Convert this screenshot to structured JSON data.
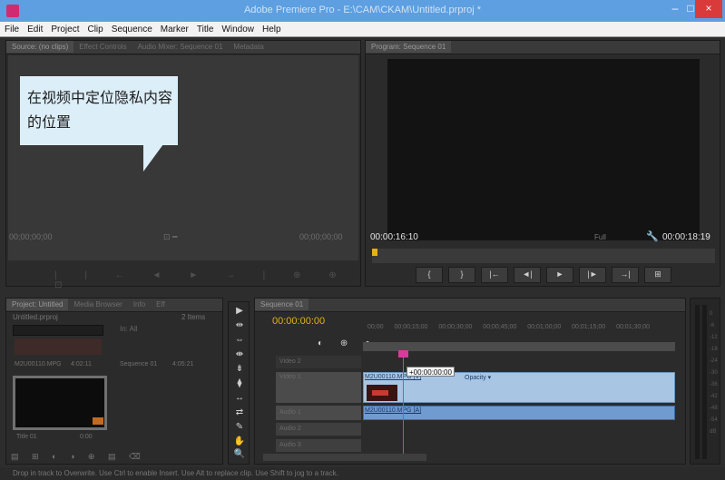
{
  "window": {
    "title": "Adobe Premiere Pro - E:\\CAM\\CKAM\\Untitled.prproj *",
    "minimize": "–",
    "maximize": "□",
    "close": "×"
  },
  "menu": [
    "File",
    "Edit",
    "Project",
    "Clip",
    "Sequence",
    "Marker",
    "Title",
    "Window",
    "Help"
  ],
  "source_panel": {
    "tabs": [
      "Source: (no clips)",
      "Effect Controls",
      "Audio Mixer: Sequence 01",
      "Metadata"
    ],
    "timecode_left": "00;00;00;00",
    "timecode_right": "00;00;00;00",
    "transport": "| | ← ◄ ► → | ⊕ ⊕ ⊡",
    "add_icon": "+"
  },
  "callout": {
    "text": "在视频中定位隐私内容的位置"
  },
  "program_panel": {
    "tab": "Program: Sequence 01",
    "timecode_left": "00:00:16:10",
    "timecode_right": "00:00:18:19",
    "fit": "Full",
    "transport": [
      "{",
      "}",
      "|←",
      "◄|",
      "►",
      "|►",
      "→|",
      "⊞",
      "⊟"
    ]
  },
  "project_panel": {
    "tabs": [
      "Project: Untitled",
      "Media Browser",
      "Info",
      "Eff"
    ],
    "project_name": "Untitled.prproj",
    "items_count": "2 Items",
    "search_placeholder": "",
    "in_label": "In: All",
    "item1_name": "M2U00110.MPG",
    "item1_duration": "4:02:11",
    "item2_name": "Sequence 01",
    "item2_duration": "4:05:21",
    "item3_name": "Title 01",
    "item3_duration": "0:00",
    "bottom_icons": "▤ ⊞ ◐ ◑ ⊕ ▤ ⌫"
  },
  "tools": [
    "▶",
    "⇹",
    "⇔",
    "⇼",
    "⇟",
    "⧫",
    "↔",
    "⇄",
    "✎",
    "✋",
    "🔍"
  ],
  "timeline": {
    "tab": "Sequence 01",
    "timecode": "00:00:00:00",
    "ruler": "00;00  00;00;15;00  00;00;30;00  00;00;45;00  00;01;00;00  00;01;15;00  00;01;30;00",
    "tools": "◐ ⊕ ●",
    "tracks": {
      "video2": "Video 2",
      "video1": "Video 1",
      "audio1": "Audio 1",
      "audio2": "Audio 2",
      "audio3": "Audio 3"
    },
    "video_clip": "M2U00110.MPG [V]",
    "video_clip_opacity": "Opacity ▾",
    "audio_clip": "M2U00110.MPG [A]",
    "tooltip": "+00:00:00:00"
  },
  "meter_scale": [
    "0",
    "-6",
    "-12",
    "-18",
    "-24",
    "-30",
    "-36",
    "-42",
    "-48",
    "-54",
    "dB"
  ],
  "status": "Drop in track to Overwrite. Use Ctrl to enable Insert. Use Alt to replace clip. Use Shift to jog to a track.",
  "colors": {
    "titlebar": "#5d9fe0",
    "close": "#d93a3a",
    "timecode_yellow": "#e2b214",
    "playhead": "#d93a9c",
    "clip_video": "#a8c6e4",
    "clip_audio": "#6f9bd1",
    "callout": "#dceef8"
  }
}
